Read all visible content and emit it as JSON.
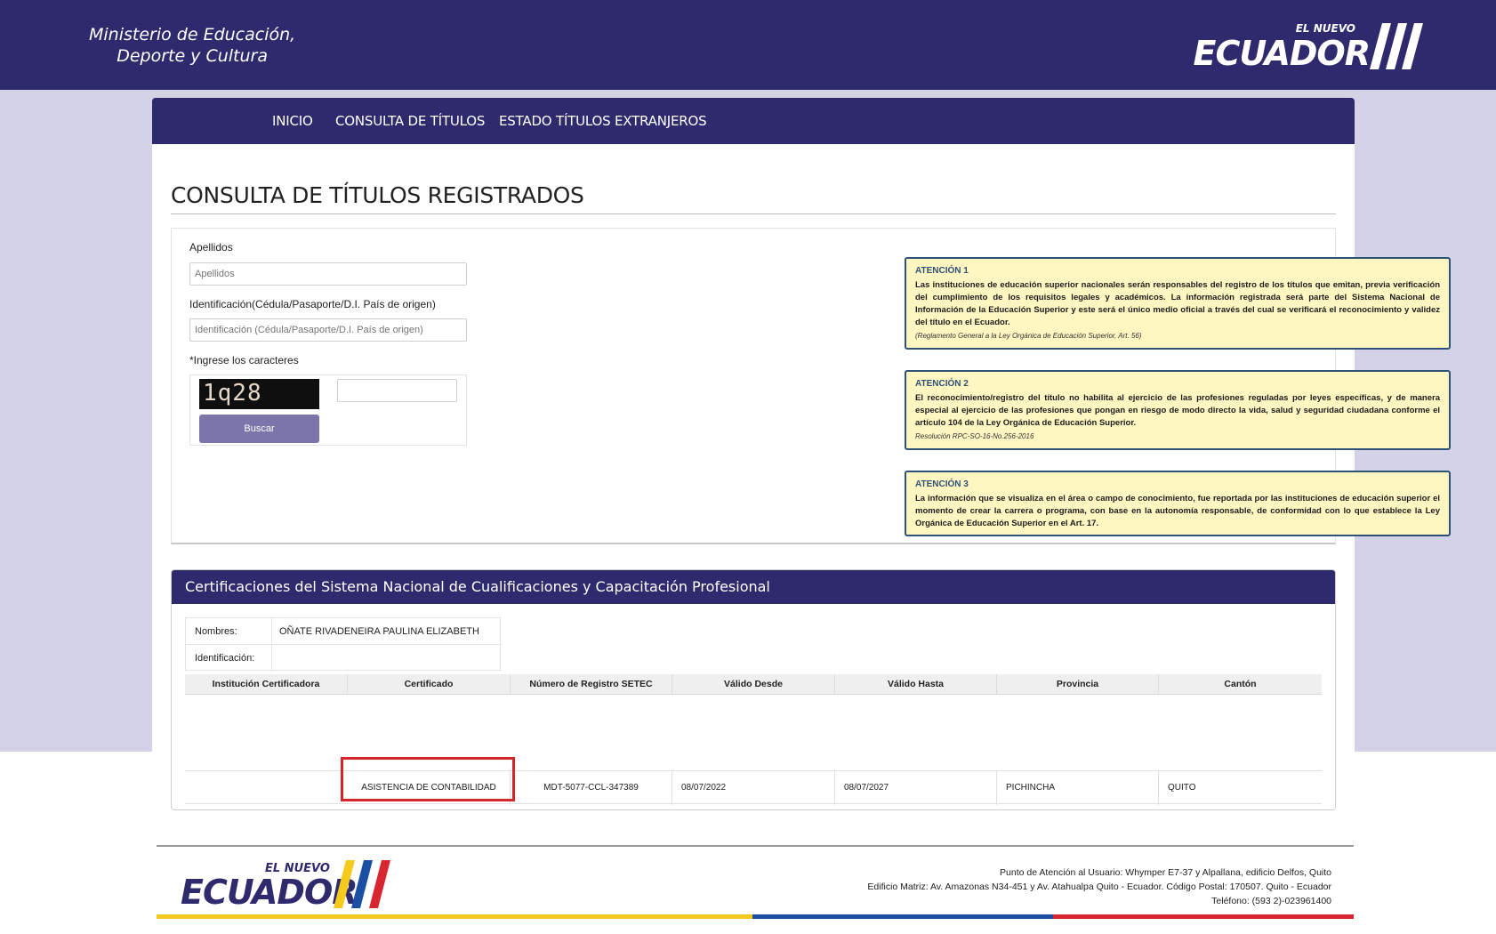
{
  "header": {
    "ministry_line1": "Ministerio de Educación,",
    "ministry_line2": "Deporte y Cultura",
    "logo_small": "EL NUEVO",
    "logo_big": "ECUADOR"
  },
  "nav": {
    "items": [
      "INICIO",
      "CONSULTA DE TÍTULOS",
      "ESTADO TÍTULOS EXTRANJEROS"
    ]
  },
  "page": {
    "title": "CONSULTA DE TÍTULOS REGISTRADOS"
  },
  "form": {
    "apellidos_label": "Apellidos",
    "apellidos_placeholder": "Apellidos",
    "identificacion_label": "Identificación(Cédula/Pasaporte/D.I. País de origen)",
    "identificacion_placeholder": "Identificación (Cédula/Pasaporte/D.I. País de origen)",
    "captcha_label": "*Ingrese los caracteres",
    "captcha_text": "1q28",
    "search_button": "Buscar"
  },
  "notices": [
    {
      "title": "ATENCIÓN 1",
      "body": "Las instituciones de educación superior nacionales serán responsables del registro de los títulos que emitan, previa verificación del cumplimiento de los requisitos legales y académicos. La información registrada será parte del Sistema Nacional de Información de la Educación Superior y este será el único medio oficial a través del cual se verificará el reconocimiento y validez del título en el Ecuador.",
      "footnote": "(Reglamento General a la Ley Orgánica de Educación Superior, Art. 56)"
    },
    {
      "title": "ATENCIÓN 2",
      "body": "El reconocimiento/registro del título no habilita al ejercicio de las profesiones reguladas por leyes específicas, y de manera especial al ejercicio de las profesiones que pongan en riesgo de modo directo la vida, salud y seguridad ciudadana conforme el artículo 104 de la Ley Orgánica de Educación Superior.",
      "footnote": "Resolución RPC-SO-16-No.256-2016"
    },
    {
      "title": "ATENCIÓN 3",
      "body": "La información que se visualiza en el área o campo de conocimiento, fue reportada por las instituciones de educación superior el momento de crear la carrera o programa, con base en la autonomía responsable, de conformidad con lo que establece la Ley Orgánica de Educación Superior en el Art. 17.",
      "footnote": ""
    }
  ],
  "certifications": {
    "heading": "Certificaciones del Sistema Nacional de Cualificaciones y Capacitación Profesional",
    "nombres_label": "Nombres:",
    "nombres_value": "OÑATE RIVADENEIRA PAULINA ELIZABETH",
    "identificacion_label": "Identificación:",
    "identificacion_value": "",
    "columns": [
      "Institución Certificadora",
      "Certificado",
      "Número de Registro SETEC",
      "Válido Desde",
      "Válido Hasta",
      "Provincia",
      "Cantón"
    ],
    "row": {
      "institucion": "",
      "certificado": "ASISTENCIA DE CONTABILIDAD",
      "registro": "MDT-5077-CCL-347389",
      "desde": "08/07/2022",
      "hasta": "08/07/2027",
      "provincia": "PICHINCHA",
      "canton": "QUITO"
    }
  },
  "footer": {
    "logo_small": "EL NUEVO",
    "logo_big": "ECUADOR",
    "line1": "Punto de Atención al Usuario: Whymper E7-37 y Alpallana, edificio Delfos, Quito",
    "line2": "Edificio Matriz: Av. Amazonas N34-451 y Av. Atahualpa Quito - Ecuador. Código Postal: 170507. Quito - Ecuador",
    "line3": "Teléfono: (593 2)-023961400"
  },
  "colors": {
    "brand": "#2f2a6e",
    "notice_bg": "#fff6c1",
    "notice_border": "#2d5278",
    "highlight": "#d7262a",
    "flag_yellow": "#f4cb1d",
    "flag_blue": "#1b4fa3",
    "flag_red": "#d72630"
  }
}
